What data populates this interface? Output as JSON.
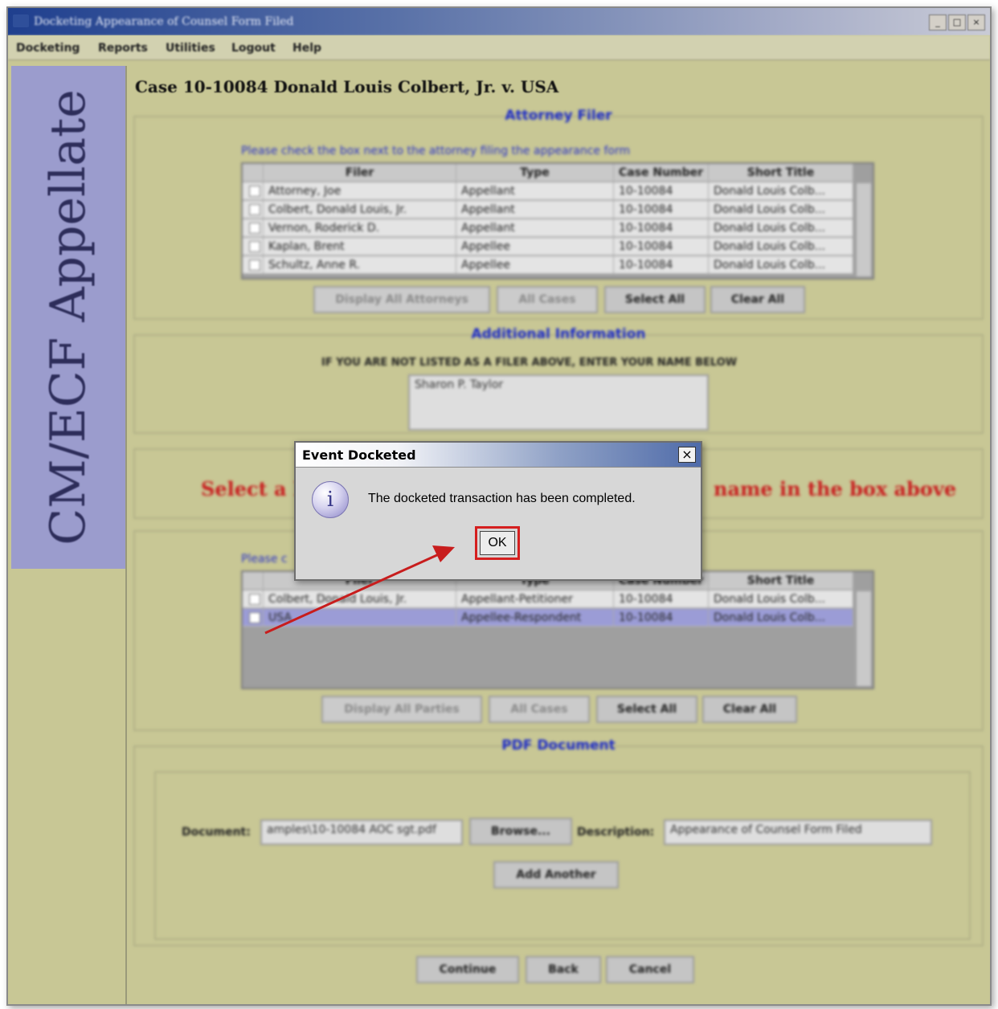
{
  "window": {
    "title": "Docketing Appearance of Counsel Form Filed",
    "controls": [
      "_",
      "□",
      "×"
    ]
  },
  "menu": [
    "Docketing",
    "Reports",
    "Utilities",
    "Logout",
    "Help"
  ],
  "sidebar": {
    "brand": "CM/ECF Appellate",
    "bg_color": "#9b9ccd"
  },
  "case_header": "Case 10-10084 Donald Louis Colbert, Jr. v. USA",
  "attorney_filer": {
    "title": "Attorney Filer",
    "instruction": "Please check the box next to the attorney filing the appearance form",
    "columns": [
      "Filer",
      "Type",
      "Case Number",
      "Short Title"
    ],
    "rows": [
      {
        "filer": "Attorney, Joe",
        "type": "Appellant",
        "case": "10-10084",
        "title": "Donald Louis Colb..."
      },
      {
        "filer": "Colbert, Donald Louis, Jr.",
        "type": "Appellant",
        "case": "10-10084",
        "title": "Donald Louis Colb..."
      },
      {
        "filer": "Vernon, Roderick D.",
        "type": "Appellant",
        "case": "10-10084",
        "title": "Donald Louis Colb..."
      },
      {
        "filer": "Kaplan, Brent",
        "type": "Appellee",
        "case": "10-10084",
        "title": "Donald Louis Colb..."
      },
      {
        "filer": "Schultz, Anne R.",
        "type": "Appellee",
        "case": "10-10084",
        "title": "Donald Louis Colb..."
      }
    ],
    "buttons": {
      "display_all": "Display All Attorneys",
      "all_cases": "All Cases",
      "select_all": "Select All",
      "clear_all": "Clear All"
    }
  },
  "additional_info": {
    "title": "Additional Information",
    "prompt": "IF YOU ARE NOT LISTED AS A FILER ABOVE, ENTER YOUR NAME BELOW",
    "name_value": "Sharon P. Taylor"
  },
  "party_notice": {
    "left": "Select a Pa",
    "right": "name in the box above"
  },
  "parties": {
    "instruction": "Please c",
    "columns": [
      "Filer",
      "Type",
      "Case Number",
      "Short Title"
    ],
    "rows": [
      {
        "filer": "Colbert, Donald Louis, Jr.",
        "type": "Appellant-Petitioner",
        "case": "10-10084",
        "title": "Donald Louis Colb..."
      },
      {
        "filer": "USA",
        "type": "Appellee-Respondent",
        "case": "10-10084",
        "title": "Donald Louis Colb..."
      }
    ],
    "buttons": {
      "display_all": "Display All Parties",
      "all_cases": "All Cases",
      "select_all": "Select All",
      "clear_all": "Clear All"
    }
  },
  "pdf": {
    "title": "PDF Document",
    "document_label": "Document:",
    "document_value": "amples\\10-10084 AOC sgt.pdf",
    "browse": "Browse...",
    "description_label": "Description:",
    "description_value": "Appearance of Counsel Form Filed",
    "add_another": "Add Another"
  },
  "footer_buttons": {
    "continue": "Continue",
    "back": "Back",
    "cancel": "Cancel"
  },
  "dialog": {
    "title": "Event Docketed",
    "close": "×",
    "message": "The docketed transaction has been completed.",
    "ok": "OK",
    "icon": "info-icon",
    "highlight_color": "#d51f1f"
  },
  "colors": {
    "background": "#c8c795",
    "section_title": "#1c2bc7",
    "alert_text": "#c82020",
    "selected_row": "#9b9cd6"
  }
}
